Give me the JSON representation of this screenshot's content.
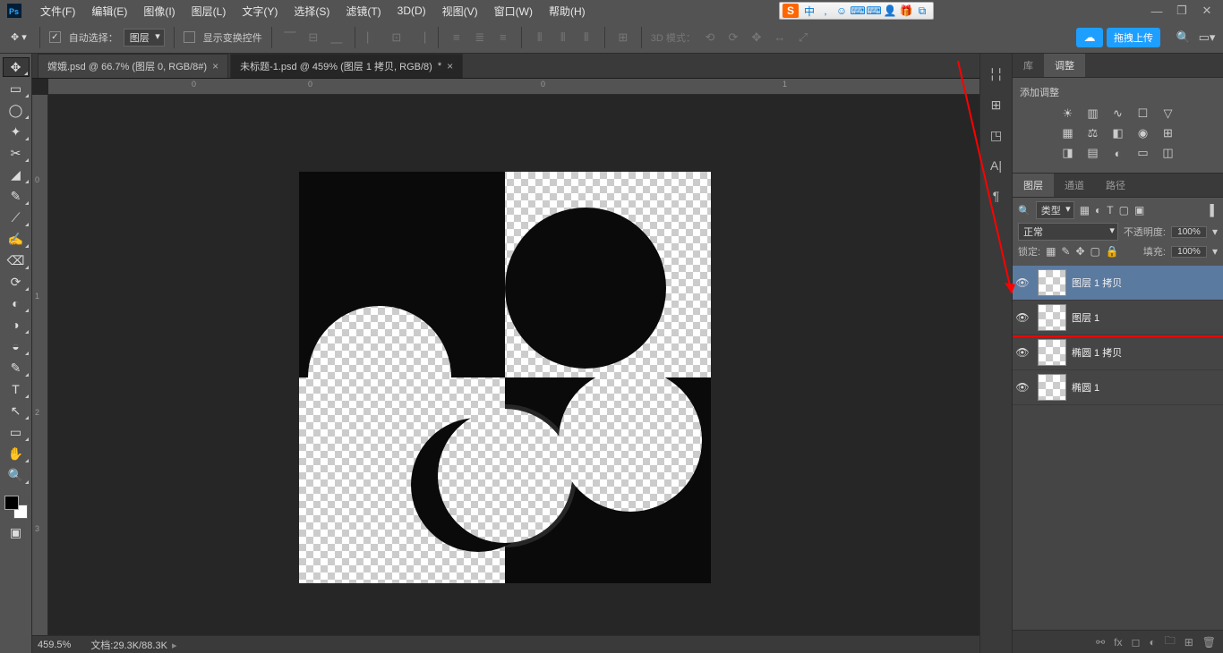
{
  "app": {
    "name": "Ps"
  },
  "menu": [
    "文件(F)",
    "编辑(E)",
    "图像(I)",
    "图层(L)",
    "文字(Y)",
    "选择(S)",
    "滤镜(T)",
    "3D(D)",
    "视图(V)",
    "窗口(W)",
    "帮助(H)"
  ],
  "ime": {
    "badge": "S",
    "chars": [
      "中",
      "‚",
      "☺",
      "⌨",
      "⌨",
      "👤",
      "🎁",
      "⧉"
    ]
  },
  "window_controls": [
    "—",
    "❐",
    "✕"
  ],
  "options": {
    "autoselect_label": "自动选择：",
    "autoselect_checked": true,
    "select_target": "图层",
    "transform_label": "显示变换控件",
    "transform_checked": false,
    "three_d_label": "3D 模式：",
    "cloud_label": "拖拽上传"
  },
  "tabs": [
    {
      "label": "嫦娥.psd @ 66.7% (图层 0, RGB/8#)",
      "closable": true,
      "active": false
    },
    {
      "label": "未标题-1.psd @ 459% (图层 1 拷贝, RGB/8)",
      "modified": "*",
      "closable": true,
      "active": true
    }
  ],
  "ruler_h": [
    " ",
    "0",
    " ",
    "1",
    " ",
    "0",
    " ",
    "1"
  ],
  "ruler_v": [
    "0",
    "1",
    "2",
    "3"
  ],
  "status": {
    "zoom": "459.5%",
    "doc_label": "文档:",
    "doc_size": "29.3K/88.3K"
  },
  "adjust_panel": {
    "tabs": [
      "库",
      "调整"
    ],
    "active_tab": 1,
    "title": "添加调整"
  },
  "layers_panel": {
    "tabs": [
      "图层",
      "通道",
      "路径"
    ],
    "active_tab": 0,
    "kind_label": "类型",
    "blend_mode": "正常",
    "opacity_label": "不透明度:",
    "opacity_val": "100%",
    "lock_label": "锁定:",
    "fill_label": "填充:",
    "fill_val": "100%",
    "layers": [
      {
        "name": "图层 1 拷贝",
        "visible": true,
        "selected": true,
        "highlighted": true
      },
      {
        "name": "图层 1",
        "visible": true,
        "selected": false,
        "highlighted": true
      },
      {
        "name": "椭圆 1 拷贝",
        "visible": true,
        "selected": false,
        "highlighted": false
      },
      {
        "name": "椭圆 1",
        "visible": true,
        "selected": false,
        "highlighted": false
      }
    ]
  },
  "tools": [
    "✥",
    "▭",
    "◯",
    "✦",
    "✂",
    "◢",
    "✎",
    "⟋",
    "✍",
    "⌫",
    "⟳",
    "◐",
    "◑",
    "◒",
    "✎",
    "T",
    "↖",
    "▭",
    "✋",
    "🔍"
  ]
}
